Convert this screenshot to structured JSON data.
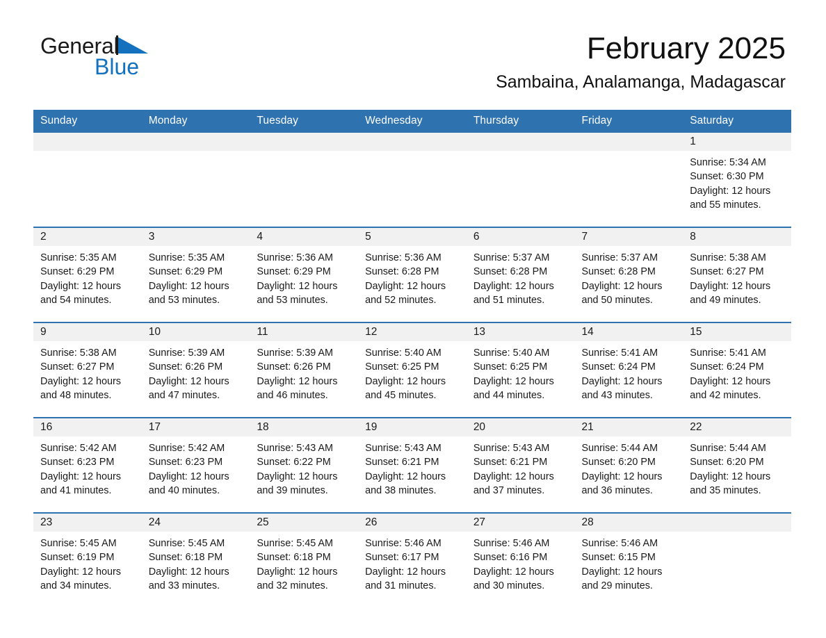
{
  "brand": {
    "name_part1": "General",
    "name_part2": "Blue",
    "triangle_icon": "blue-triangle-logo",
    "accent_color": "#1471bd"
  },
  "header": {
    "month_title": "February 2025",
    "location": "Sambaina, Analamanga, Madagascar",
    "header_bg_color": "#2e72b0",
    "daynum_band_color": "#f1f1f1",
    "week_separator_color": "#2e72b0"
  },
  "weekday_headers": [
    "Sunday",
    "Monday",
    "Tuesday",
    "Wednesday",
    "Thursday",
    "Friday",
    "Saturday"
  ],
  "weeks": [
    [
      {
        "day": "",
        "lines": []
      },
      {
        "day": "",
        "lines": []
      },
      {
        "day": "",
        "lines": []
      },
      {
        "day": "",
        "lines": []
      },
      {
        "day": "",
        "lines": []
      },
      {
        "day": "",
        "lines": []
      },
      {
        "day": "1",
        "lines": [
          "Sunrise: 5:34 AM",
          "Sunset: 6:30 PM",
          "Daylight: 12 hours",
          "and 55 minutes."
        ]
      }
    ],
    [
      {
        "day": "2",
        "lines": [
          "Sunrise: 5:35 AM",
          "Sunset: 6:29 PM",
          "Daylight: 12 hours",
          "and 54 minutes."
        ]
      },
      {
        "day": "3",
        "lines": [
          "Sunrise: 5:35 AM",
          "Sunset: 6:29 PM",
          "Daylight: 12 hours",
          "and 53 minutes."
        ]
      },
      {
        "day": "4",
        "lines": [
          "Sunrise: 5:36 AM",
          "Sunset: 6:29 PM",
          "Daylight: 12 hours",
          "and 53 minutes."
        ]
      },
      {
        "day": "5",
        "lines": [
          "Sunrise: 5:36 AM",
          "Sunset: 6:28 PM",
          "Daylight: 12 hours",
          "and 52 minutes."
        ]
      },
      {
        "day": "6",
        "lines": [
          "Sunrise: 5:37 AM",
          "Sunset: 6:28 PM",
          "Daylight: 12 hours",
          "and 51 minutes."
        ]
      },
      {
        "day": "7",
        "lines": [
          "Sunrise: 5:37 AM",
          "Sunset: 6:28 PM",
          "Daylight: 12 hours",
          "and 50 minutes."
        ]
      },
      {
        "day": "8",
        "lines": [
          "Sunrise: 5:38 AM",
          "Sunset: 6:27 PM",
          "Daylight: 12 hours",
          "and 49 minutes."
        ]
      }
    ],
    [
      {
        "day": "9",
        "lines": [
          "Sunrise: 5:38 AM",
          "Sunset: 6:27 PM",
          "Daylight: 12 hours",
          "and 48 minutes."
        ]
      },
      {
        "day": "10",
        "lines": [
          "Sunrise: 5:39 AM",
          "Sunset: 6:26 PM",
          "Daylight: 12 hours",
          "and 47 minutes."
        ]
      },
      {
        "day": "11",
        "lines": [
          "Sunrise: 5:39 AM",
          "Sunset: 6:26 PM",
          "Daylight: 12 hours",
          "and 46 minutes."
        ]
      },
      {
        "day": "12",
        "lines": [
          "Sunrise: 5:40 AM",
          "Sunset: 6:25 PM",
          "Daylight: 12 hours",
          "and 45 minutes."
        ]
      },
      {
        "day": "13",
        "lines": [
          "Sunrise: 5:40 AM",
          "Sunset: 6:25 PM",
          "Daylight: 12 hours",
          "and 44 minutes."
        ]
      },
      {
        "day": "14",
        "lines": [
          "Sunrise: 5:41 AM",
          "Sunset: 6:24 PM",
          "Daylight: 12 hours",
          "and 43 minutes."
        ]
      },
      {
        "day": "15",
        "lines": [
          "Sunrise: 5:41 AM",
          "Sunset: 6:24 PM",
          "Daylight: 12 hours",
          "and 42 minutes."
        ]
      }
    ],
    [
      {
        "day": "16",
        "lines": [
          "Sunrise: 5:42 AM",
          "Sunset: 6:23 PM",
          "Daylight: 12 hours",
          "and 41 minutes."
        ]
      },
      {
        "day": "17",
        "lines": [
          "Sunrise: 5:42 AM",
          "Sunset: 6:23 PM",
          "Daylight: 12 hours",
          "and 40 minutes."
        ]
      },
      {
        "day": "18",
        "lines": [
          "Sunrise: 5:43 AM",
          "Sunset: 6:22 PM",
          "Daylight: 12 hours",
          "and 39 minutes."
        ]
      },
      {
        "day": "19",
        "lines": [
          "Sunrise: 5:43 AM",
          "Sunset: 6:21 PM",
          "Daylight: 12 hours",
          "and 38 minutes."
        ]
      },
      {
        "day": "20",
        "lines": [
          "Sunrise: 5:43 AM",
          "Sunset: 6:21 PM",
          "Daylight: 12 hours",
          "and 37 minutes."
        ]
      },
      {
        "day": "21",
        "lines": [
          "Sunrise: 5:44 AM",
          "Sunset: 6:20 PM",
          "Daylight: 12 hours",
          "and 36 minutes."
        ]
      },
      {
        "day": "22",
        "lines": [
          "Sunrise: 5:44 AM",
          "Sunset: 6:20 PM",
          "Daylight: 12 hours",
          "and 35 minutes."
        ]
      }
    ],
    [
      {
        "day": "23",
        "lines": [
          "Sunrise: 5:45 AM",
          "Sunset: 6:19 PM",
          "Daylight: 12 hours",
          "and 34 minutes."
        ]
      },
      {
        "day": "24",
        "lines": [
          "Sunrise: 5:45 AM",
          "Sunset: 6:18 PM",
          "Daylight: 12 hours",
          "and 33 minutes."
        ]
      },
      {
        "day": "25",
        "lines": [
          "Sunrise: 5:45 AM",
          "Sunset: 6:18 PM",
          "Daylight: 12 hours",
          "and 32 minutes."
        ]
      },
      {
        "day": "26",
        "lines": [
          "Sunrise: 5:46 AM",
          "Sunset: 6:17 PM",
          "Daylight: 12 hours",
          "and 31 minutes."
        ]
      },
      {
        "day": "27",
        "lines": [
          "Sunrise: 5:46 AM",
          "Sunset: 6:16 PM",
          "Daylight: 12 hours",
          "and 30 minutes."
        ]
      },
      {
        "day": "28",
        "lines": [
          "Sunrise: 5:46 AM",
          "Sunset: 6:15 PM",
          "Daylight: 12 hours",
          "and 29 minutes."
        ]
      },
      {
        "day": "",
        "lines": []
      }
    ]
  ]
}
